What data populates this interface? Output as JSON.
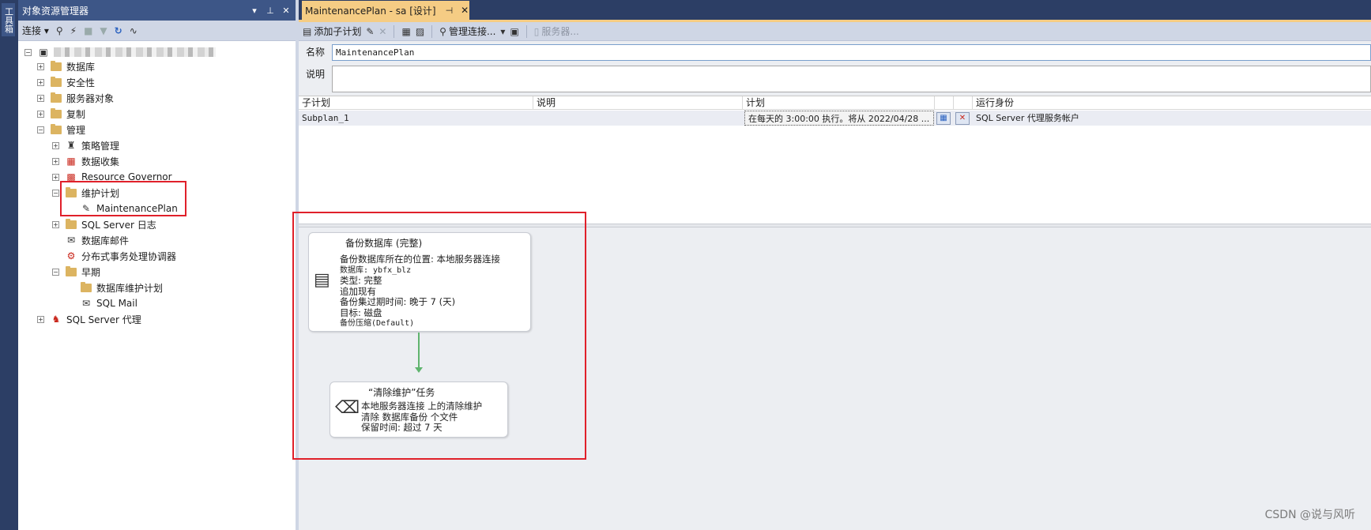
{
  "toolbox": {
    "label": "工具箱"
  },
  "object_explorer": {
    "title": "对象资源管理器",
    "title_buttons": [
      "▾",
      "⊥",
      "✕"
    ],
    "toolbar": {
      "connect_label": "连接 ▾"
    },
    "tree": [
      {
        "label": "数据库",
        "expander": "+",
        "icon": "folder"
      },
      {
        "label": "安全性",
        "expander": "+",
        "icon": "folder"
      },
      {
        "label": "服务器对象",
        "expander": "+",
        "icon": "folder"
      },
      {
        "label": "复制",
        "expander": "+",
        "icon": "folder"
      },
      {
        "label": "管理",
        "expander": "−",
        "icon": "folder"
      },
      {
        "label": "策略管理",
        "expander": "+",
        "icon": "policy"
      },
      {
        "label": "数据收集",
        "expander": "+",
        "icon": "data-collection"
      },
      {
        "label": "Resource Governor",
        "expander": "+",
        "icon": "resource-governor"
      },
      {
        "label": "维护计划",
        "expander": "−",
        "icon": "folder"
      },
      {
        "label": "MaintenancePlan",
        "expander": "",
        "icon": "maintenance-plan"
      },
      {
        "label": "SQL Server 日志",
        "expander": "+",
        "icon": "folder"
      },
      {
        "label": "数据库邮件",
        "expander": "",
        "icon": "database-mail"
      },
      {
        "label": "分布式事务处理协调器",
        "expander": "",
        "icon": "dtc"
      },
      {
        "label": "早期",
        "expander": "−",
        "icon": "folder"
      },
      {
        "label": "数据库维护计划",
        "expander": "",
        "icon": "folder"
      },
      {
        "label": "SQL Mail",
        "expander": "",
        "icon": "sql-mail"
      },
      {
        "label": "SQL Server 代理",
        "expander": "+",
        "icon": "sql-agent"
      }
    ]
  },
  "document_tab": {
    "title": "MaintenancePlan - sa [设计]",
    "pin": "⊣",
    "close": "✕"
  },
  "designer_toolbar": {
    "add_subplan_label": "添加子计划",
    "manage_connections_label": "管理连接...",
    "servers_label": "服务器..."
  },
  "properties": {
    "name_label": "名称",
    "name_value": "MaintenancePlan",
    "description_label": "说明",
    "description_value": ""
  },
  "subplans": {
    "headers": [
      "子计划",
      "说明",
      "计划",
      "运行身份"
    ],
    "rows": [
      {
        "subplan": "Subplan_1",
        "description": "",
        "schedule": "在每天的 3:00:00 执行。将从 2022/04/28 ...",
        "run_as": "SQL Server 代理服务帐户"
      }
    ]
  },
  "tasks": {
    "backup": {
      "title": "备份数据库 (完整)",
      "lines": [
        {
          "text": "备份数据库所在的位置: 本地服务器连接",
          "mono": false
        },
        {
          "text": "数据库: ybfx_blz",
          "mono": true
        },
        {
          "text": "类型: 完整",
          "mono": false
        },
        {
          "text": "追加现有",
          "mono": false
        },
        {
          "text": "备份集过期时间: 晚于 7 (天)",
          "mono": false
        },
        {
          "text": "目标: 磁盘",
          "mono": false
        },
        {
          "text": "备份压缩(Default)",
          "mono": true
        }
      ]
    },
    "cleanup": {
      "title": "“清除维护”任务",
      "lines": [
        "本地服务器连接 上的清除维护",
        "清除 数据库备份 个文件",
        "保留时间: 超过 7 天"
      ]
    }
  },
  "watermark": "CSDN @说与风听",
  "colors": {
    "chrome_dark": "#2c3e65",
    "tab_active": "#f5cc84",
    "toolbar": "#cfd6e5",
    "highlight_box": "#e0202a",
    "connector": "#5fb46e"
  }
}
